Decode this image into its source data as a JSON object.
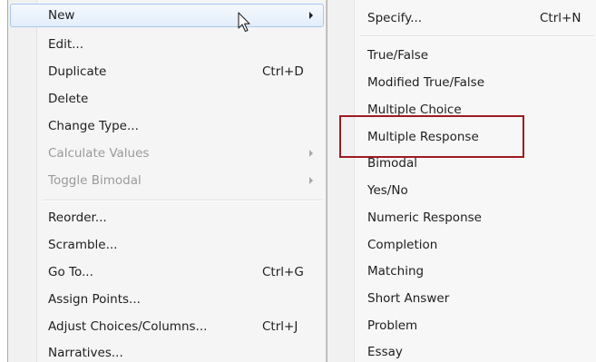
{
  "context_menu": {
    "items": [
      {
        "label": "New",
        "shortcut": "",
        "submenu": true,
        "disabled": false,
        "highlighted": true
      },
      {
        "label": "Edit...",
        "shortcut": "",
        "submenu": false,
        "disabled": false
      },
      {
        "label": "Duplicate",
        "shortcut": "Ctrl+D",
        "submenu": false,
        "disabled": false
      },
      {
        "label": "Delete",
        "shortcut": "",
        "submenu": false,
        "disabled": false
      },
      {
        "label": "Change Type...",
        "shortcut": "",
        "submenu": false,
        "disabled": false
      },
      {
        "label": "Calculate Values",
        "shortcut": "",
        "submenu": true,
        "disabled": true
      },
      {
        "label": "Toggle Bimodal",
        "shortcut": "",
        "submenu": true,
        "disabled": true
      },
      {
        "label": "Reorder...",
        "shortcut": "",
        "submenu": false,
        "disabled": false
      },
      {
        "label": "Scramble...",
        "shortcut": "",
        "submenu": false,
        "disabled": false
      },
      {
        "label": "Go To...",
        "shortcut": "Ctrl+G",
        "submenu": false,
        "disabled": false
      },
      {
        "label": "Assign Points...",
        "shortcut": "",
        "submenu": false,
        "disabled": false
      },
      {
        "label": "Adjust Choices/Columns...",
        "shortcut": "Ctrl+J",
        "submenu": false,
        "disabled": false
      },
      {
        "label": "Narratives...",
        "shortcut": "",
        "submenu": false,
        "disabled": false
      }
    ]
  },
  "new_submenu": {
    "items": [
      {
        "label": "Specify...",
        "shortcut": "Ctrl+N"
      },
      {
        "label": "True/False"
      },
      {
        "label": "Modified True/False"
      },
      {
        "label": "Multiple Choice"
      },
      {
        "label": "Multiple Response",
        "annotated": true
      },
      {
        "label": "Bimodal"
      },
      {
        "label": "Yes/No"
      },
      {
        "label": "Numeric Response"
      },
      {
        "label": "Completion"
      },
      {
        "label": "Matching"
      },
      {
        "label": "Short Answer"
      },
      {
        "label": "Problem"
      },
      {
        "label": "Essay"
      }
    ]
  },
  "colors": {
    "annotation_box": "#9e1b1f",
    "hover_fill": "#e3eefb",
    "hover_border": "#a9c7ee",
    "disabled_text": "#9a9a9a"
  },
  "icons": {
    "cursor": "mouse-pointer-icon",
    "submenu_arrow": "submenu-arrow-icon"
  }
}
